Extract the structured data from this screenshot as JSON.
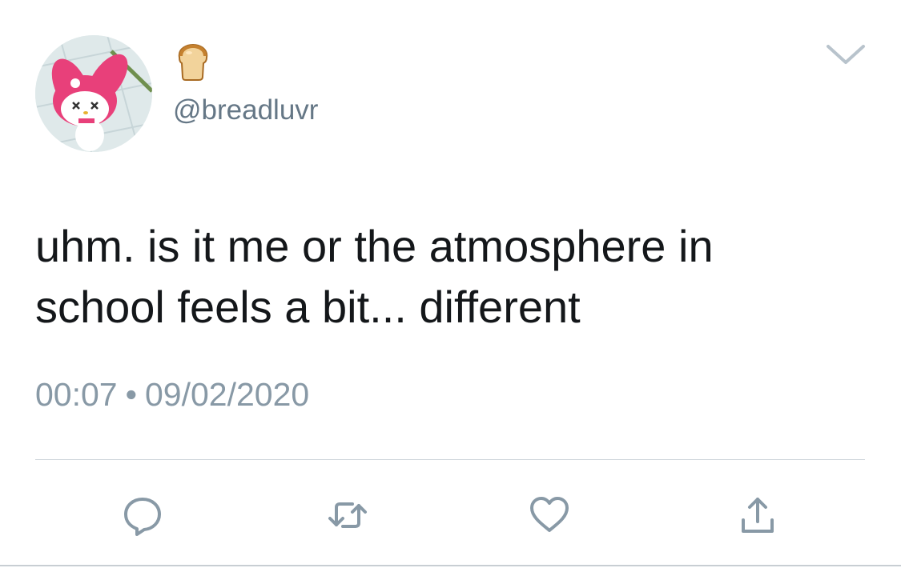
{
  "tweet": {
    "display_name_emoji_icon": "bread-emoji",
    "handle": "@breadluvr",
    "text_lines": [
      "uhm. is it me or the atmosphere in",
      "school feels a bit... different"
    ],
    "time": "00:07",
    "separator": "•",
    "date": "09/02/2020"
  },
  "actions": {
    "reply_icon": "speech-bubble-icon",
    "retweet_icon": "retweet-icon",
    "like_icon": "heart-icon",
    "share_icon": "share-icon"
  },
  "colors": {
    "text": "#14171a",
    "muted": "#657786",
    "icon": "#8899a6",
    "avatar_pink": "#e8407a"
  }
}
